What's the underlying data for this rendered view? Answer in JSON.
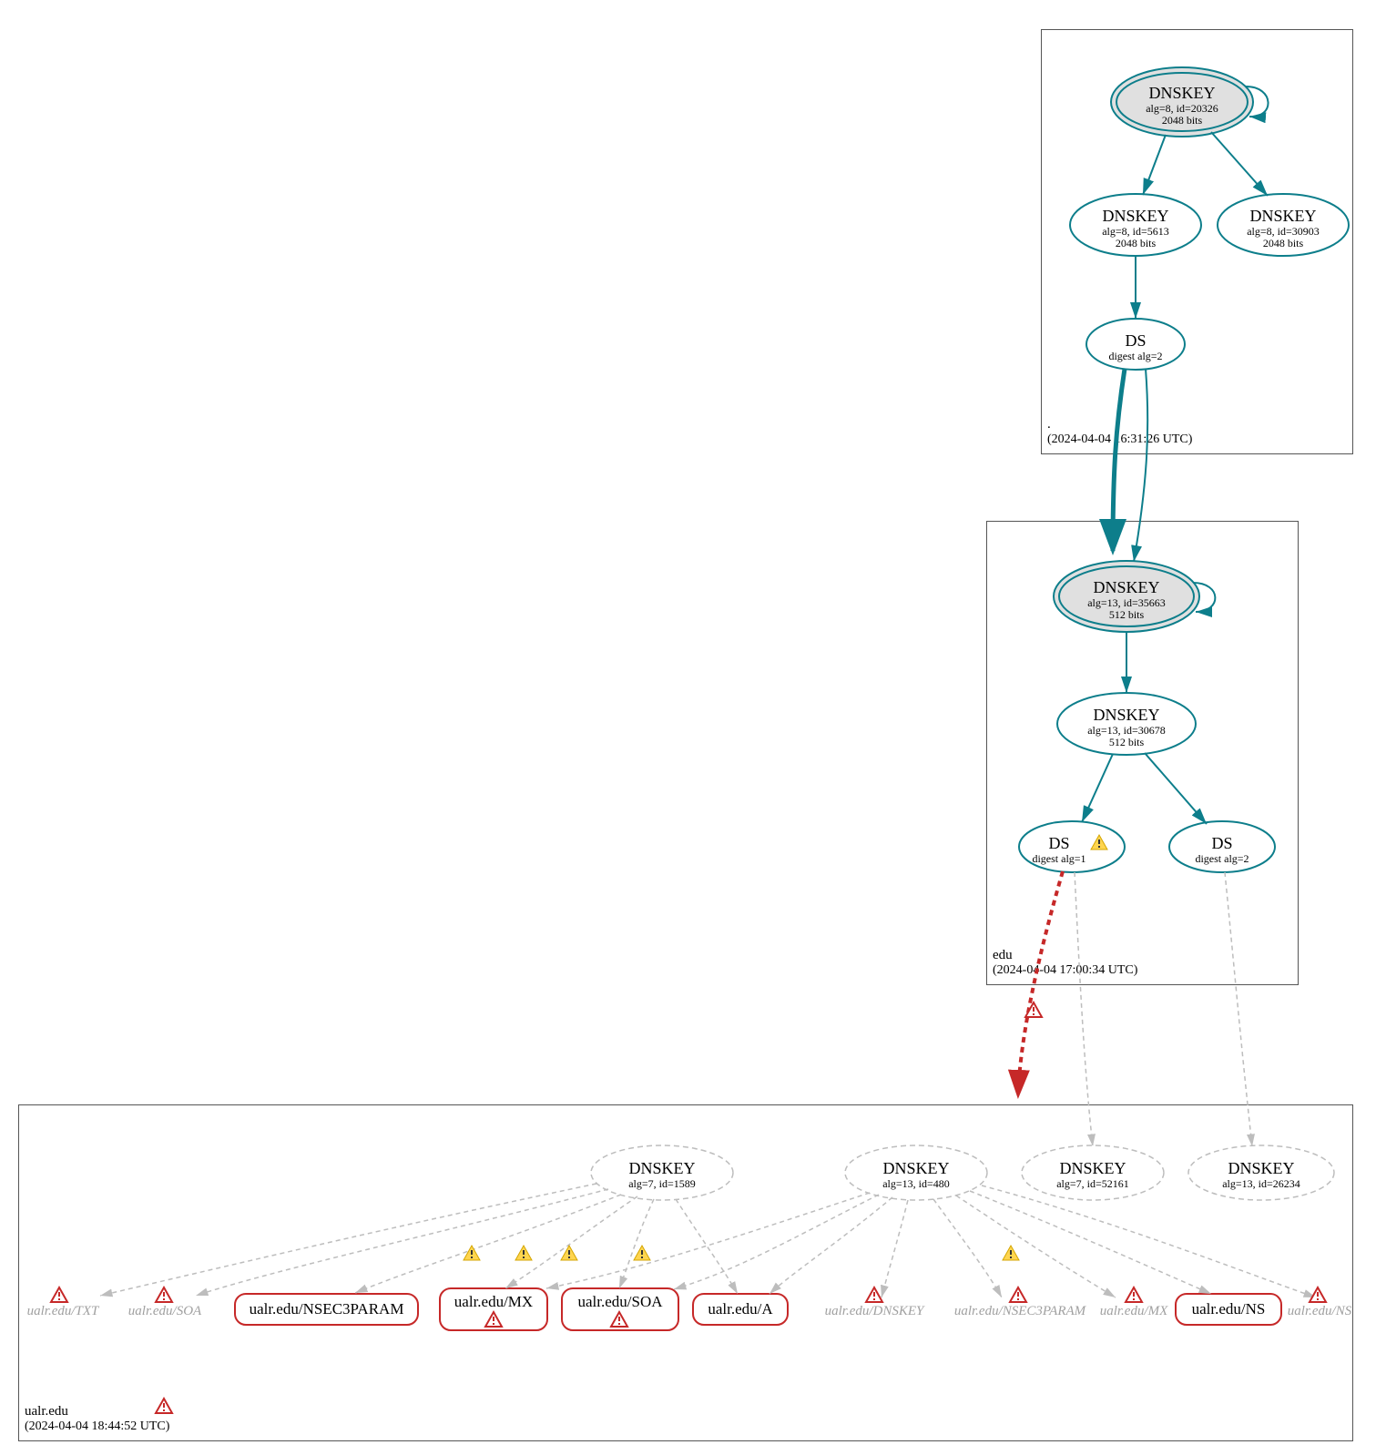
{
  "zones": {
    "root": {
      "label": ".",
      "timestamp": "(2024-04-04 16:31:26 UTC)"
    },
    "edu": {
      "label": "edu",
      "timestamp": "(2024-04-04 17:00:34 UTC)"
    },
    "ualr": {
      "label": "ualr.edu",
      "timestamp": "(2024-04-04 18:44:52 UTC)"
    }
  },
  "nodes": {
    "root_ksk": {
      "title": "DNSKEY",
      "sub1": "alg=8, id=20326",
      "sub2": "2048 bits"
    },
    "root_zsk1": {
      "title": "DNSKEY",
      "sub1": "alg=8, id=5613",
      "sub2": "2048 bits"
    },
    "root_zsk2": {
      "title": "DNSKEY",
      "sub1": "alg=8, id=30903",
      "sub2": "2048 bits"
    },
    "root_ds": {
      "title": "DS",
      "sub1": "digest alg=2"
    },
    "edu_ksk": {
      "title": "DNSKEY",
      "sub1": "alg=13, id=35663",
      "sub2": "512 bits"
    },
    "edu_zsk": {
      "title": "DNSKEY",
      "sub1": "alg=13, id=30678",
      "sub2": "512 bits"
    },
    "edu_ds1": {
      "title": "DS",
      "sub1": "digest alg=1"
    },
    "edu_ds2": {
      "title": "DS",
      "sub1": "digest alg=2"
    },
    "ualr_k1": {
      "title": "DNSKEY",
      "sub1": "alg=7, id=1589"
    },
    "ualr_k2": {
      "title": "DNSKEY",
      "sub1": "alg=13, id=480"
    },
    "ualr_k3": {
      "title": "DNSKEY",
      "sub1": "alg=7, id=52161"
    },
    "ualr_k4": {
      "title": "DNSKEY",
      "sub1": "alg=13, id=26234"
    },
    "rr_txt": {
      "title": "ualr.edu/TXT"
    },
    "rr_soa_l": {
      "title": "ualr.edu/SOA"
    },
    "rr_nsec3p": {
      "title": "ualr.edu/NSEC3PARAM"
    },
    "rr_mx": {
      "title": "ualr.edu/MX"
    },
    "rr_soa": {
      "title": "ualr.edu/SOA"
    },
    "rr_a": {
      "title": "ualr.edu/A"
    },
    "rr_dnskey": {
      "title": "ualr.edu/DNSKEY"
    },
    "rr_nsec3p_r": {
      "title": "ualr.edu/NSEC3PARAM"
    },
    "rr_mx_r": {
      "title": "ualr.edu/MX"
    },
    "rr_ns": {
      "title": "ualr.edu/NS"
    },
    "rr_ns_r": {
      "title": "ualr.edu/NS"
    }
  }
}
